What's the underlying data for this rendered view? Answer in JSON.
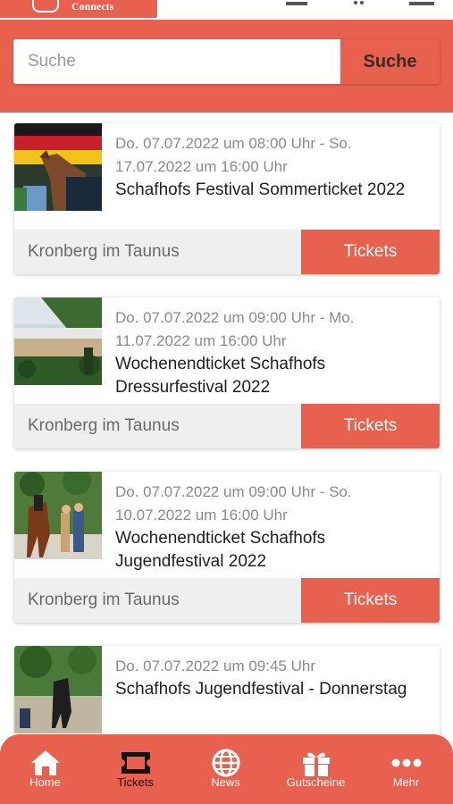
{
  "app": {
    "logo_text": "Connects"
  },
  "search": {
    "placeholder": "Suche",
    "button_label": "Suche"
  },
  "events": [
    {
      "date": "Do. 07.07.2022 um 08:00 Uhr - So. 17.07.2022 um 16:00 Uhr",
      "title": "Schafhofs Festival Sommerticket 2022",
      "location": "Kronberg im Taunus",
      "button": "Tickets"
    },
    {
      "date": "Do. 07.07.2022 um 09:00 Uhr - Mo. 11.07.2022 um 16:00 Uhr",
      "title": "Wochenendticket Schafhofs Dressurfestival 2022",
      "location": "Kronberg im Taunus",
      "button": "Tickets"
    },
    {
      "date": "Do. 07.07.2022 um 09:00 Uhr - So. 10.07.2022 um 16:00 Uhr",
      "title": "Wochenendticket Schafhofs Jugendfestival 2022",
      "location": "Kronberg im Taunus",
      "button": "Tickets"
    },
    {
      "date": "Do. 07.07.2022 um 09:45 Uhr",
      "title": "Schafhofs Jugendfestival - Donnerstag"
    }
  ],
  "nav": {
    "items": [
      {
        "label": "Home",
        "icon": "home-icon"
      },
      {
        "label": "Tickets",
        "icon": "ticket-icon",
        "active": true
      },
      {
        "label": "News",
        "icon": "globe-icon"
      },
      {
        "label": "Gutscheine",
        "icon": "gift-icon"
      },
      {
        "label": "Mehr",
        "icon": "more-dots-icon"
      }
    ]
  },
  "colors": {
    "accent": "#e8604e",
    "active_nav": "#111111"
  }
}
